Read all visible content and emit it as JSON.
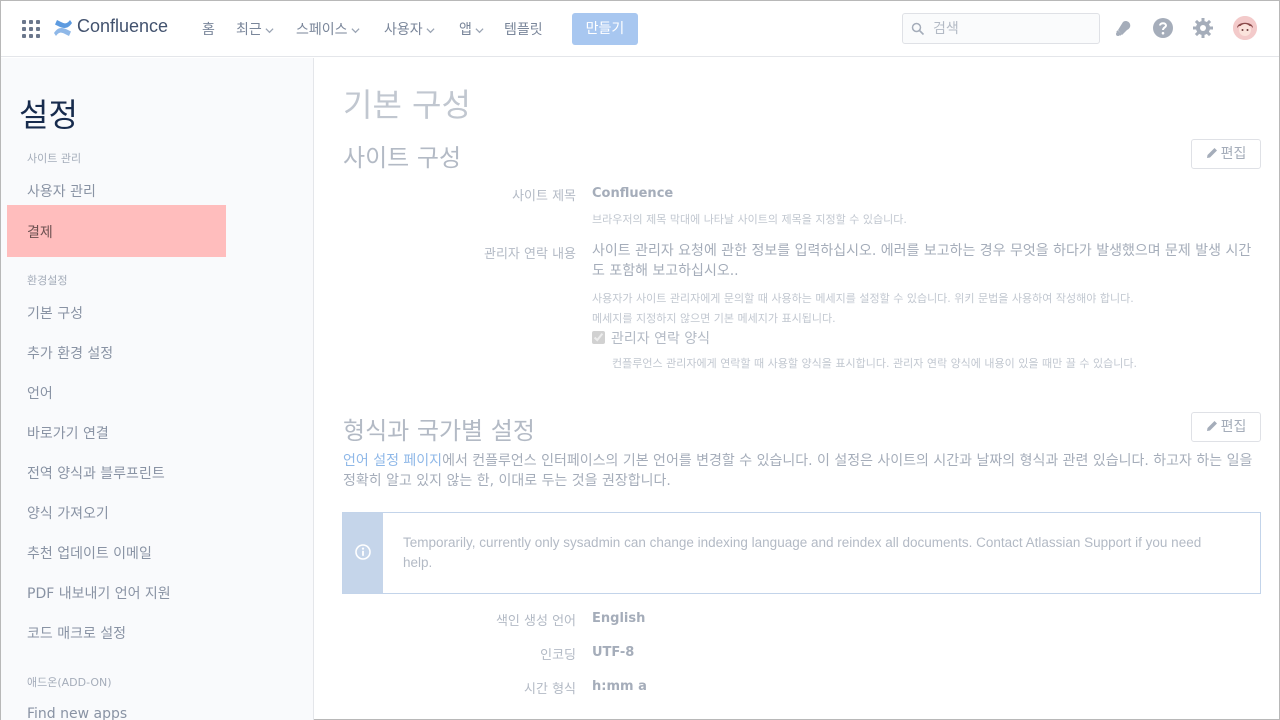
{
  "topnav": {
    "logo": "Confluence",
    "items": [
      {
        "label": "홈",
        "has_menu": false
      },
      {
        "label": "최근",
        "has_menu": true
      },
      {
        "label": "스페이스",
        "has_menu": true
      },
      {
        "label": "사용자",
        "has_menu": true
      },
      {
        "label": "앱",
        "has_menu": true
      },
      {
        "label": "템플릿",
        "has_menu": false
      }
    ],
    "create_label": "만들기",
    "search_placeholder": "검색",
    "icons": [
      "notification-icon",
      "help-icon",
      "settings-icon",
      "avatar"
    ]
  },
  "sidebar": {
    "title": "설정",
    "sections": [
      {
        "label": "사이트 관리",
        "items": [
          "사용자 관리",
          "결제"
        ]
      },
      {
        "label": "환경설정",
        "items": [
          "기본 구성",
          "추가 환경 설정",
          "언어",
          "바로가기 연결",
          "전역 양식과 블루프린트",
          "양식 가져오기",
          "추천 업데이트 이메일",
          "PDF 내보내기 언어 지원",
          "코드 매크로 설정"
        ]
      },
      {
        "label": "애드온(ADD-ON)",
        "items": [
          "Find new apps"
        ]
      }
    ],
    "active_item": "결제"
  },
  "main": {
    "page_title": "기본 구성",
    "site_config": {
      "title": "사이트 구성",
      "edit_label": "편집",
      "site_title_label": "사이트 제목",
      "site_title_value": "Confluence",
      "site_title_desc": "브라우저의 제목 막대에 나타날 사이트의 제목을 지정할 수 있습니다.",
      "contact_label": "관리자 연락 내용",
      "contact_value": "사이트 관리자 요청에 관한 정보를 입력하십시오. 에러를 보고하는 경우 무엇을 하다가 발생했으며 문제 발생 시간도 포함해 보고하십시오..",
      "contact_desc_1": "사용자가 사이트 관리자에게 문의할 때 사용하는 메세지를 설정할 수 있습니다. 위키 문법을 사용하여 작성해야 합니다.",
      "contact_desc_2": "메세지를 지정하지 않으면 기본 메세지가 표시됩니다.",
      "contact_form_label": "관리자 연락 양식",
      "contact_form_checked": true,
      "contact_form_desc": "컨플루언스 관리자에게 연락할 때 사용할 양식을 표시합니다. 관리자 연락 양식에 내용이 있을 때만 끌 수 있습니다."
    },
    "locale": {
      "title": "형식과 국가별 설정",
      "edit_label": "편집",
      "link_text": "언어 설정 페이지",
      "paragraph": "에서 컨플루언스 인터페이스의 기본 언어를 변경할 수 있습니다. 이 설정은 사이트의 시간과 날짜의 형식과 관련 있습니다. 하고자 하는 일을 정확히 알고 있지 않는 한, 이대로 두는 것을 권장합니다.",
      "info_message": "Temporarily, currently only sysadmin can change indexing language and reindex all documents. Contact Atlassian Support if you need help.",
      "fields": [
        {
          "label": "색인 생성 언어",
          "value": "English"
        },
        {
          "label": "인코딩",
          "value": "UTF-8"
        },
        {
          "label": "시간 형식",
          "value": "h:mm a"
        }
      ]
    }
  },
  "colors": {
    "accent": "#0052cc",
    "active_highlight": "#ffbdbd",
    "create_button": "#a8c7f0",
    "info_bar": "#c5d5ea"
  }
}
